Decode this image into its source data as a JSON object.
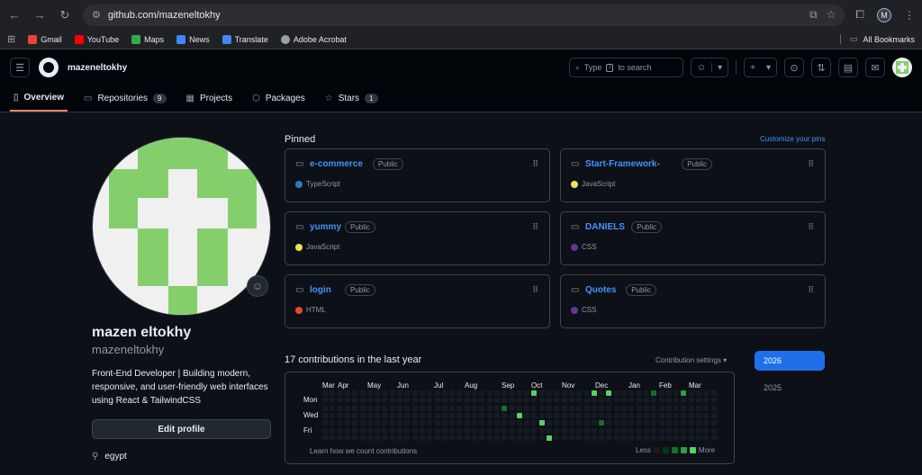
{
  "browser": {
    "url": "github.com/mazeneltokhy",
    "profile_initial": "M",
    "bookmarks": [
      "Gmail",
      "YouTube",
      "Maps",
      "News",
      "Translate",
      "Adobe Acrobat"
    ],
    "all_bookmarks": "All Bookmarks"
  },
  "header": {
    "username": "mazeneltokhy",
    "search_before": "Type",
    "search_key": "/",
    "search_after": "to search"
  },
  "tabs": [
    {
      "label": "Overview",
      "icon": "book-icon"
    },
    {
      "label": "Repositories",
      "count": "9",
      "icon": "repo-icon"
    },
    {
      "label": "Projects",
      "icon": "table-icon"
    },
    {
      "label": "Packages",
      "icon": "package-icon"
    },
    {
      "label": "Stars",
      "count": "1",
      "icon": "star-icon"
    }
  ],
  "profile": {
    "full_name": "mazen eltokhy",
    "login": "mazeneltokhy",
    "bio": "Front-End Developer | Building modern, responsive, and user-friendly web interfaces using React & TailwindCSS",
    "edit_label": "Edit profile",
    "location": "egypt"
  },
  "pinned": {
    "title": "Pinned",
    "customize": "Customize your pins",
    "repos": [
      {
        "name": "e-commerce",
        "visibility": "Public",
        "language": "TypeScript",
        "color": "#3178c6"
      },
      {
        "name": "Start-Framework-",
        "visibility": "Public",
        "language": "JavaScript",
        "color": "#f1e05a"
      },
      {
        "name": "yummy",
        "visibility": "Public",
        "language": "JavaScript",
        "color": "#f1e05a"
      },
      {
        "name": "DANIELS",
        "visibility": "Public",
        "language": "CSS",
        "color": "#663399"
      },
      {
        "name": "login",
        "visibility": "Public",
        "language": "HTML",
        "color": "#e34c26"
      },
      {
        "name": "Quotes",
        "visibility": "Public",
        "language": "CSS",
        "color": "#663399"
      }
    ]
  },
  "contributions": {
    "title": "17 contributions in the last year",
    "settings": "Contribution settings",
    "months": [
      "Mar",
      "Apr",
      "May",
      "Jun",
      "Jul",
      "Aug",
      "Sep",
      "Oct",
      "Nov",
      "Dec",
      "Jan",
      "Feb",
      "Mar"
    ],
    "days": [
      "Mon",
      "Wed",
      "Fri"
    ],
    "learn": "Learn how we count contributions",
    "less": "Less",
    "more": "More",
    "years": [
      "2026",
      "2025"
    ]
  }
}
